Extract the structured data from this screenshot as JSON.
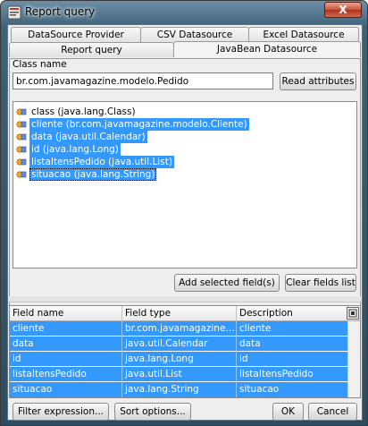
{
  "window": {
    "title": "Report query",
    "close_glyph": "X",
    "close_color": "#c8553d"
  },
  "tabs": {
    "row1": [
      "DataSource Provider",
      "CSV Datasource",
      "Excel Datasource"
    ],
    "row2": [
      "Report query",
      "JavaBean Datasource"
    ],
    "active": "JavaBean Datasource"
  },
  "class_section": {
    "label": "Class name",
    "value": "br.com.javamagazine.modelo.Pedido",
    "read_button": "Read attributes"
  },
  "attributes": [
    {
      "text": "class (java.lang.Class)",
      "selected": false,
      "icon": "field-icon"
    },
    {
      "text": "cliente (br.com.javamagazine.modelo.Cliente)",
      "selected": true,
      "icon": "field-icon"
    },
    {
      "text": "data (java.util.Calendar)",
      "selected": true,
      "icon": "field-icon"
    },
    {
      "text": "id (java.lang.Long)",
      "selected": true,
      "icon": "field-icon"
    },
    {
      "text": "listaItensPedido (java.util.List)",
      "selected": true,
      "icon": "field-icon"
    },
    {
      "text": "situacao (java.lang.String)",
      "selected": true,
      "icon": "field-icon"
    }
  ],
  "actions": {
    "add_selected": "Add selected field(s)",
    "clear_fields": "Clear fields list"
  },
  "fields_table": {
    "columns": [
      "Field name",
      "Field type",
      "Description"
    ],
    "rows": [
      [
        "cliente",
        "br.com.javamagazine.mod...",
        "cliente"
      ],
      [
        "data",
        "java.util.Calendar",
        "data"
      ],
      [
        "id",
        "java.lang.Long",
        "id"
      ],
      [
        "listaItensPedido",
        "java.util.List",
        "listaItensPedido"
      ],
      [
        "situacao",
        "java.lang.String",
        "situacao"
      ]
    ],
    "selection_color": "#3399ff"
  },
  "footer": {
    "filter": "Filter expression...",
    "sort": "Sort options...",
    "ok": "OK",
    "cancel": "Cancel"
  }
}
